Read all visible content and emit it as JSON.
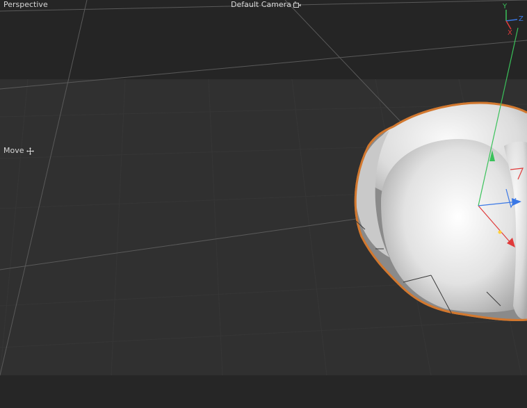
{
  "viewport": {
    "view_name": "Perspective",
    "camera_name": "Default Camera",
    "camera_icon": "camera-icon",
    "tool_name": "Move",
    "tool_icon": "move-cross-icon"
  },
  "axis_widget": {
    "y_label": "Y",
    "z_label": "Z",
    "x_label": "X"
  },
  "colors": {
    "background_upper": "#252525",
    "background_grid": "#303030",
    "background_lower": "#262626",
    "grid_line": "#3b3b3b",
    "grid_major": "#5a5a5a",
    "selection_outline": "#d2782f",
    "axis_x": "#e03a3a",
    "axis_y": "#3ac25a",
    "axis_z": "#3a78e6",
    "object_fill": "#e6e6e6"
  }
}
